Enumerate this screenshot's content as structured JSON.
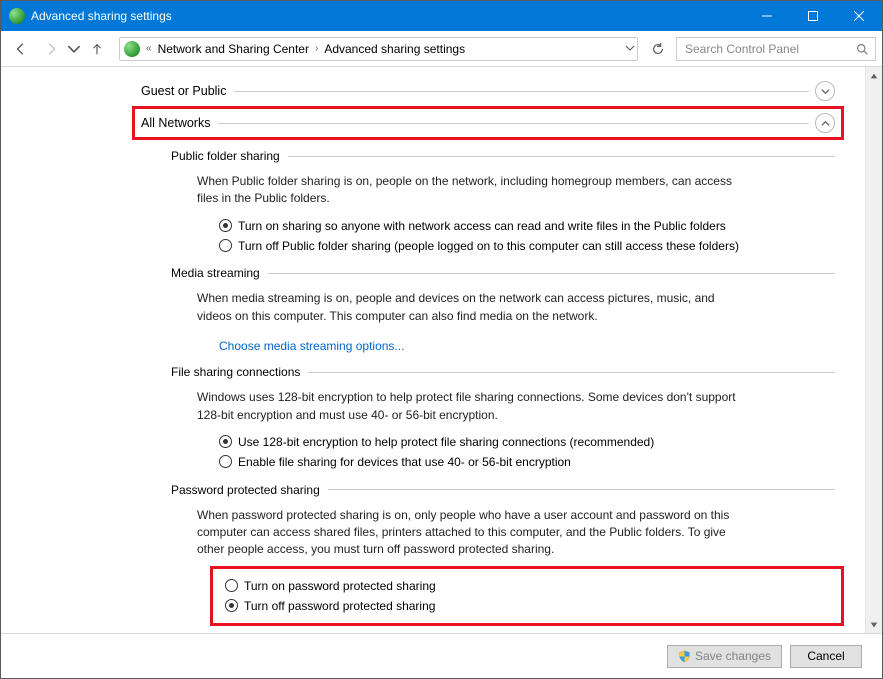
{
  "window": {
    "title": "Advanced sharing settings"
  },
  "breadcrumb": {
    "chev": "«",
    "item1": "Network and Sharing Center",
    "item2": "Advanced sharing settings"
  },
  "search": {
    "placeholder": "Search Control Panel"
  },
  "profiles": {
    "guest": "Guest or Public",
    "all": "All Networks"
  },
  "publicFolder": {
    "title": "Public folder sharing",
    "desc": "When Public folder sharing is on, people on the network, including homegroup members, can access files in the Public folders.",
    "opt1": "Turn on sharing so anyone with network access can read and write files in the Public folders",
    "opt2": "Turn off Public folder sharing (people logged on to this computer can still access these folders)"
  },
  "media": {
    "title": "Media streaming",
    "desc": "When media streaming is on, people and devices on the network can access pictures, music, and videos on this computer. This computer can also find media on the network.",
    "link": "Choose media streaming options..."
  },
  "fileShare": {
    "title": "File sharing connections",
    "desc": "Windows uses 128-bit encryption to help protect file sharing connections. Some devices don't support 128-bit encryption and must use 40- or 56-bit encryption.",
    "opt1": "Use 128-bit encryption to help protect file sharing connections (recommended)",
    "opt2": "Enable file sharing for devices that use 40- or 56-bit encryption"
  },
  "password": {
    "title": "Password protected sharing",
    "desc": "When password protected sharing is on, only people who have a user account and password on this computer can access shared files, printers attached to this computer, and the Public folders. To give other people access, you must turn off password protected sharing.",
    "opt1": "Turn on password protected sharing",
    "opt2": "Turn off password protected sharing"
  },
  "footer": {
    "save": "Save changes",
    "cancel": "Cancel"
  }
}
